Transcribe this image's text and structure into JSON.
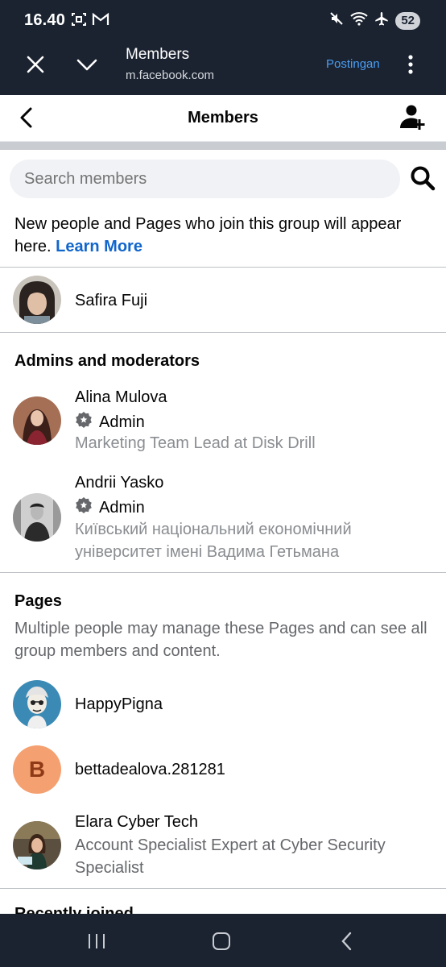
{
  "status_bar": {
    "time": "16.40",
    "battery": "52",
    "icons": [
      "screenshot-icon",
      "gmail-icon",
      "mute-icon",
      "wifi-icon",
      "airplane-icon"
    ]
  },
  "browser": {
    "title": "Members",
    "url": "m.facebook.com",
    "action": "Postingan"
  },
  "header": {
    "title": "Members"
  },
  "search": {
    "placeholder": "Search members"
  },
  "info": {
    "text": "New people and Pages who join this group will appear here. ",
    "link": "Learn More"
  },
  "current_user": {
    "name": "Safira Fuji"
  },
  "admins": {
    "title": "Admins and moderators",
    "members": [
      {
        "name": "Alina Mulova",
        "role": "Admin",
        "subtitle": "Marketing Team Lead at Disk Drill"
      },
      {
        "name": "Andrii Yasko",
        "role": "Admin",
        "subtitle": "Київський національний економічний університет імені Вадима Гетьмана"
      }
    ]
  },
  "pages": {
    "title": "Pages",
    "description": "Multiple people may manage these Pages and can see all group members and content.",
    "items": [
      {
        "name": "HappyPigna",
        "subtitle": ""
      },
      {
        "name": "bettadealova.281281",
        "initial": "B",
        "subtitle": ""
      },
      {
        "name": "Elara Cyber Tech",
        "subtitle": "Account Specialist Expert at Cyber Security Specialist"
      }
    ]
  },
  "next_section": {
    "title": "Recently joined"
  },
  "colors": {
    "chrome": "#1b2330",
    "link": "#1166cc",
    "browser_action": "#4a9df5",
    "initial_avatar": "#f5a070"
  }
}
